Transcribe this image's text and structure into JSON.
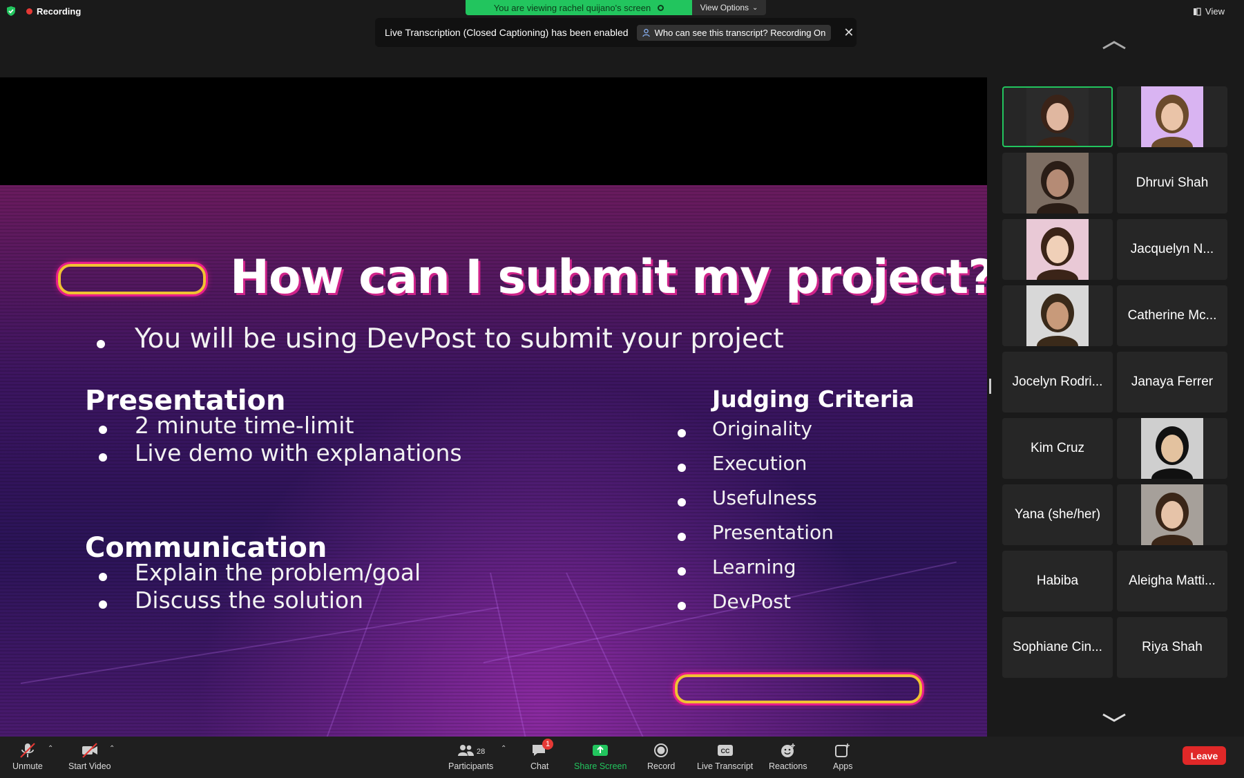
{
  "top": {
    "recording": "Recording",
    "viewing_banner": "You are viewing rachel quijano's screen",
    "view_options": "View Options",
    "view": "View",
    "transcription_notice": "Live Transcription (Closed Captioning) has been enabled",
    "transcript_pill": "Who can see this transcript? Recording On"
  },
  "slide": {
    "title": "How can I submit my project?",
    "intro_bullet": "You will be using DevPost to submit your project",
    "presentation": {
      "heading": "Presentation",
      "items": [
        "2 minute time-limit",
        "Live demo with explanations"
      ]
    },
    "communication": {
      "heading": "Communication",
      "items": [
        "Explain the problem/goal",
        "Discuss the solution"
      ]
    },
    "judging": {
      "heading": "Judging Criteria",
      "items": [
        "Originality",
        "Execution",
        "Usefulness",
        "Presentation",
        "Learning",
        "DevPost"
      ]
    }
  },
  "participants": [
    {
      "name": "",
      "video": true,
      "active": true,
      "bg": "#2b2b2b",
      "skin": "#e0b7a0",
      "hair": "#3a2318"
    },
    {
      "name": "",
      "video": true,
      "active": false,
      "bg": "#d9b4f2",
      "skin": "#eac4a8",
      "hair": "#6b4b2c"
    },
    {
      "name": "",
      "video": true,
      "active": false,
      "bg": "#7c6d62",
      "skin": "#b58b75",
      "hair": "#2a1d16"
    },
    {
      "name": "Dhruvi Shah",
      "video": false
    },
    {
      "name": "",
      "video": true,
      "active": false,
      "bg": "#e9c9d6",
      "skin": "#f0d0b8",
      "hair": "#3b2418"
    },
    {
      "name": "Jacquelyn N...",
      "video": false
    },
    {
      "name": "",
      "video": true,
      "active": false,
      "bg": "#d8d8d8",
      "skin": "#c89a7a",
      "hair": "#3a2a1a"
    },
    {
      "name": "Catherine Mc...",
      "video": false
    },
    {
      "name": "Jocelyn Rodri...",
      "video": false
    },
    {
      "name": "Janaya Ferrer",
      "video": false
    },
    {
      "name": "Kim Cruz",
      "video": false
    },
    {
      "name": "",
      "video": true,
      "active": false,
      "bg": "#cfcfcf",
      "skin": "#e3c29f",
      "hair": "#111111"
    },
    {
      "name": "Yana (she/her)",
      "video": false
    },
    {
      "name": "",
      "video": true,
      "active": false,
      "bg": "#a6a09a",
      "skin": "#e6c3a8",
      "hair": "#3a2618"
    },
    {
      "name": "Habiba",
      "video": false
    },
    {
      "name": "Aleigha Matti...",
      "video": false
    },
    {
      "name": "Sophiane Cin...",
      "video": false
    },
    {
      "name": "Riya Shah",
      "video": false
    }
  ],
  "toolbar": {
    "unmute": "Unmute",
    "start_video": "Start Video",
    "participants": "Participants",
    "participants_count": "28",
    "chat": "Chat",
    "chat_badge": "1",
    "share_screen": "Share Screen",
    "record": "Record",
    "live_transcript": "Live Transcript",
    "reactions": "Reactions",
    "apps": "Apps",
    "leave": "Leave"
  },
  "colors": {
    "accent_green": "#22c55e",
    "leave_red": "#e02828",
    "neon_pink": "#e91e8c",
    "neon_yellow": "#f1c232"
  }
}
